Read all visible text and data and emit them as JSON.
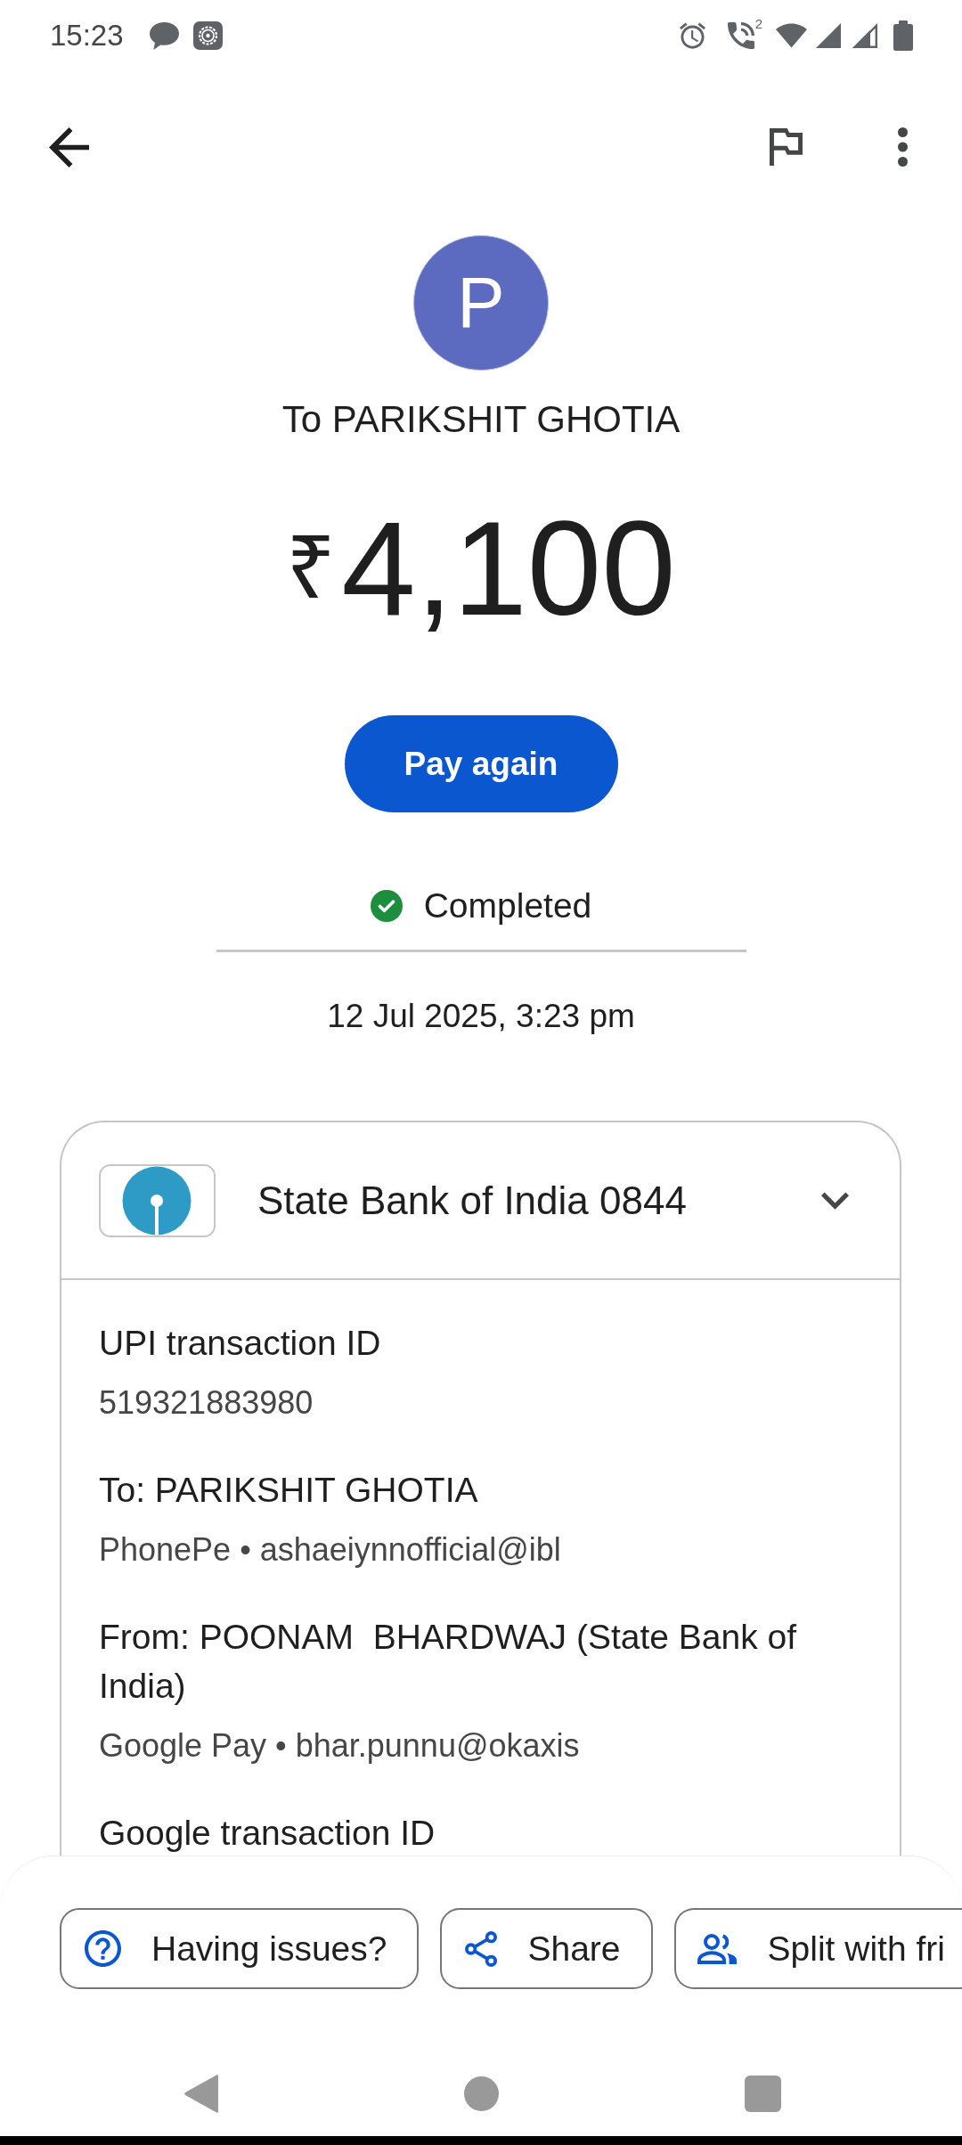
{
  "status_bar": {
    "time": "15:23",
    "call_sim": "2"
  },
  "recipient": {
    "initial": "P",
    "title": "To PARIKSHIT GHOTIA"
  },
  "amount": {
    "currency": "₹",
    "value": "4,100"
  },
  "primary_action": {
    "label": "Pay again"
  },
  "status": {
    "label": "Completed"
  },
  "timestamp": "12 Jul 2025, 3:23 pm",
  "account": {
    "name": "State Bank of India 0844"
  },
  "details": [
    {
      "label": "UPI transaction ID",
      "value": "519321883980"
    },
    {
      "label": "To: PARIKSHIT GHOTIA",
      "value": "PhonePe • ashaeiynnofficial@ibl"
    },
    {
      "label": "From: POONAM  BHARDWAJ (State Bank of India)",
      "value": "Google Pay • bhar.punnu@okaxis"
    },
    {
      "label": "Google transaction ID"
    }
  ],
  "actions": [
    {
      "kind": "help",
      "label": "Having issues?"
    },
    {
      "kind": "share",
      "label": "Share"
    },
    {
      "kind": "split",
      "label": "Split with fri"
    }
  ]
}
